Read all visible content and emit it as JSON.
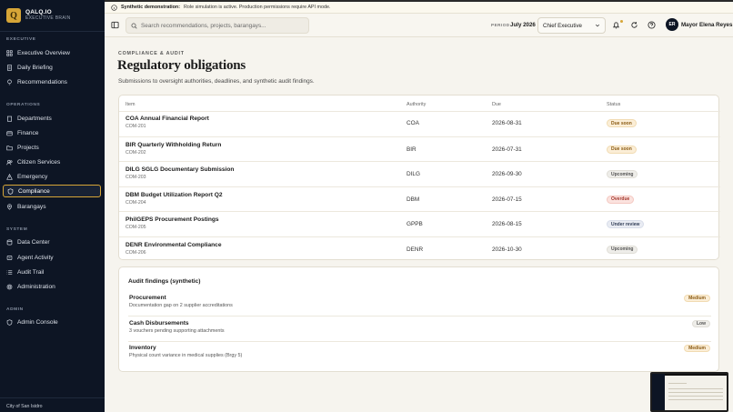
{
  "brand": {
    "logo_letter": "Q",
    "name": "QALQ.IO",
    "subtitle": "EXECUTIVE BRAIN"
  },
  "sidebar": {
    "sections": [
      {
        "label": "EXECUTIVE",
        "items": [
          {
            "label": "Executive Overview",
            "icon": "grid-icon"
          },
          {
            "label": "Daily Briefing",
            "icon": "document-icon"
          },
          {
            "label": "Recommendations",
            "icon": "lightbulb-icon"
          }
        ]
      },
      {
        "label": "OPERATIONS",
        "items": [
          {
            "label": "Departments",
            "icon": "building-icon"
          },
          {
            "label": "Finance",
            "icon": "wallet-icon"
          },
          {
            "label": "Projects",
            "icon": "folder-icon"
          },
          {
            "label": "Citizen Services",
            "icon": "users-icon"
          },
          {
            "label": "Emergency",
            "icon": "alert-icon"
          },
          {
            "label": "Compliance",
            "icon": "shield-icon",
            "active": true
          },
          {
            "label": "Barangays",
            "icon": "map-pin-icon"
          }
        ]
      },
      {
        "label": "SYSTEM",
        "items": [
          {
            "label": "Data Center",
            "icon": "database-icon"
          },
          {
            "label": "Agent Activity",
            "icon": "activity-icon"
          },
          {
            "label": "Audit Trail",
            "icon": "list-icon"
          },
          {
            "label": "Administration",
            "icon": "settings-icon"
          }
        ]
      },
      {
        "label": "ADMIN",
        "items": [
          {
            "label": "Admin Console",
            "icon": "shield-icon"
          }
        ]
      }
    ],
    "footer": "City of San Isidro"
  },
  "banner": {
    "bold": "Synthetic demonstration:",
    "text": "Role simulation is active. Production permissions require API mode."
  },
  "header": {
    "search_placeholder": "Search recommendations, projects, barangays...",
    "period_label": "PERIOD",
    "period_value": "July 2026",
    "role_value": "Chief Executive",
    "avatar_initials": "ER",
    "user_name": "Mayor Elena Reyes"
  },
  "page": {
    "eyebrow": "COMPLIANCE & AUDIT",
    "title": "Regulatory obligations",
    "subtitle": "Submissions to oversight authorities, deadlines, and synthetic audit findings."
  },
  "obligations": {
    "columns": [
      "Item",
      "Authority",
      "Due",
      "Status"
    ],
    "rows": [
      {
        "name": "COA Annual Financial Report",
        "code": "COM-201",
        "authority": "COA",
        "due": "2026-08-31",
        "status": "Due soon",
        "status_kind": "due-soon"
      },
      {
        "name": "BIR Quarterly Withholding Return",
        "code": "COM-202",
        "authority": "BIR",
        "due": "2026-07-31",
        "status": "Due soon",
        "status_kind": "due-soon"
      },
      {
        "name": "DILG SGLG Documentary Submission",
        "code": "COM-203",
        "authority": "DILG",
        "due": "2026-09-30",
        "status": "Upcoming",
        "status_kind": "upcoming"
      },
      {
        "name": "DBM Budget Utilization Report Q2",
        "code": "COM-204",
        "authority": "DBM",
        "due": "2026-07-15",
        "status": "Overdue",
        "status_kind": "overdue"
      },
      {
        "name": "PhilGEPS Procurement Postings",
        "code": "COM-205",
        "authority": "GPPB",
        "due": "2026-08-15",
        "status": "Under review",
        "status_kind": "under-review"
      },
      {
        "name": "DENR Environmental Compliance",
        "code": "COM-206",
        "authority": "DENR",
        "due": "2026-10-30",
        "status": "Upcoming",
        "status_kind": "upcoming"
      }
    ]
  },
  "findings": {
    "title": "Audit findings (synthetic)",
    "items": [
      {
        "name": "Procurement",
        "desc": "Documentation gap on 2 supplier accreditations",
        "severity": "Medium",
        "severity_kind": "medium"
      },
      {
        "name": "Cash Disbursements",
        "desc": "3 vouchers pending supporting attachments",
        "severity": "Low",
        "severity_kind": "low"
      },
      {
        "name": "Inventory",
        "desc": "Physical count variance in medical supplies (Brgy 5)",
        "severity": "Medium",
        "severity_kind": "medium"
      }
    ]
  },
  "colors": {
    "sidebar_bg": "#0d1524",
    "accent": "#d6a537",
    "page_bg": "#f6f4ee"
  }
}
